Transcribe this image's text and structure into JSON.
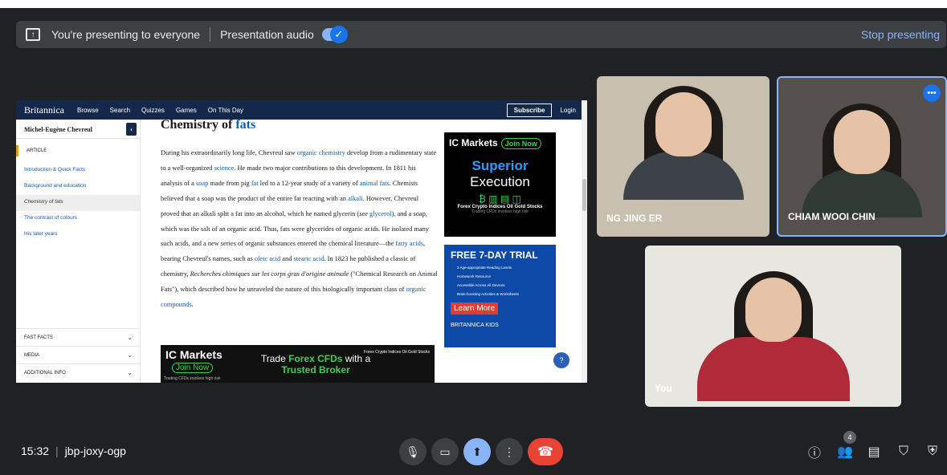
{
  "presentation_bar": {
    "status": "You're presenting to everyone",
    "audio_label": "Presentation audio",
    "stop": "Stop presenting"
  },
  "britannica": {
    "logo": "Britannica",
    "nav": [
      "Browse",
      "Search",
      "Quizzes",
      "Games",
      "On This Day"
    ],
    "subscribe": "Subscribe",
    "login": "Login",
    "sidebar_title": "Michel-Eugène Chevreul",
    "article_label": "ARTICLE",
    "toc": [
      "Introduction & Quick Facts",
      "Background and education",
      "Chemistry of fats",
      "The contrast of colours",
      "His later years"
    ],
    "sections": [
      "FAST FACTS",
      "MEDIA",
      "ADDITIONAL INFO"
    ],
    "heading_plain": "Chemistry of ",
    "heading_link": "fats",
    "paragraph": [
      {
        "t": "During his extraordinarily long life, Chevreul saw "
      },
      {
        "t": "organic chemistry",
        "link": true
      },
      {
        "t": " develop from a "
      },
      {
        "t": "rudimentary"
      },
      {
        "t": " state to a well-organized "
      },
      {
        "t": "science",
        "link": true
      },
      {
        "t": ". He made two major contributions to this development. In 1811 his analysis of a "
      },
      {
        "t": "soap",
        "link": true
      },
      {
        "t": " made from pig "
      },
      {
        "t": "fat",
        "link": true
      },
      {
        "t": " led to a 12-year study of a variety of "
      },
      {
        "t": "animal fats",
        "link": true
      },
      {
        "t": ". Chemists believed that a soap was the product of the entire fat reacting with an "
      },
      {
        "t": "alkali",
        "link": true
      },
      {
        "t": ". However, Chevreul proved that an alkali split a fat into an alcohol, which he named glycerin ("
      },
      {
        "t": "see",
        "italic": true
      },
      {
        "t": " "
      },
      {
        "t": "glycerol",
        "link": true
      },
      {
        "t": "), and a soap, which was the salt of an organic acid. Thus, fats were glycerides of organic acids. He isolated many such acids, and a new series of organic substances entered the chemical literature—the "
      },
      {
        "t": "fatty acids",
        "link": true
      },
      {
        "t": ", bearing Chevreul's names, such as "
      },
      {
        "t": "oleic acid",
        "link": true
      },
      {
        "t": " and "
      },
      {
        "t": "stearic acid",
        "link": true
      },
      {
        "t": ". In 1823 he published a classic of chemistry, "
      },
      {
        "t": "Recherches chimiques sur les corps gras d'origine animale",
        "italic": true
      },
      {
        "t": " (\"Chemical Research on Animal Fats\"), which described how he unraveled the nature of this biologically important class of "
      },
      {
        "t": "organic compounds",
        "link": true
      },
      {
        "t": "."
      }
    ],
    "ad_right": {
      "brand": "IC Markets",
      "join": "Join Now",
      "line1": "Superior",
      "line2": "Execution",
      "markets": "Forex  Crypto  Indices  Oil  Gold  Stocks",
      "fine": "Trading CFDs involves high risk"
    },
    "ad_trial": {
      "title": "FREE 7-DAY TRIAL",
      "items": [
        "3 Age-appropriate Reading Levels",
        "Homework Resource",
        "Accessible Across All Devices",
        "Brain-boosting Activities & Worksheets"
      ],
      "cta": "Learn More",
      "brand": "BRITANNICA KIDS"
    },
    "ad_bottom": {
      "brand": "IC Markets",
      "join": "Join Now",
      "fine": "Trading CFDs involves high risk",
      "trade_pre": "Trade ",
      "trade_bold": "Forex CFDs",
      "trade_post": " with a",
      "trade_line2": "Trusted Broker",
      "markets": "Forex  Crypto  Indices  Oil  Gold  Stocks"
    }
  },
  "participants": [
    {
      "name": "NG JING ER",
      "shirt": "#3c4248",
      "bg": "#c8bfae"
    },
    {
      "name": "CHIAM WOOI CHIN",
      "shirt": "#2f3a35",
      "bg": "#55504d"
    },
    {
      "name": "You",
      "shirt": "#b02a3a",
      "bg": "#e8e6e1"
    }
  ],
  "bottom_bar": {
    "time": "15:32",
    "meeting_code": "jbp-joxy-ogp",
    "participant_count": "4"
  }
}
